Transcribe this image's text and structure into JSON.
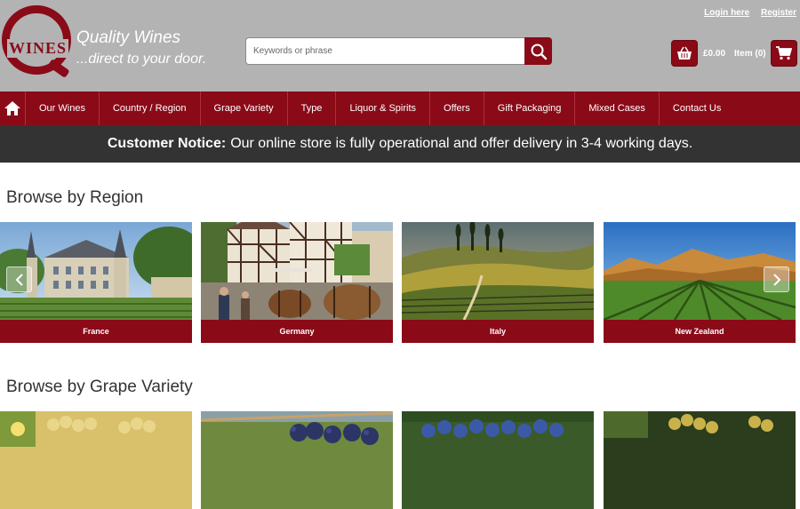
{
  "brand": {
    "logo_text": "WINES",
    "tagline_1": "Quality Wines",
    "tagline_2": "...direct to your door."
  },
  "account": {
    "login_label": "Login here",
    "register_label": "Register"
  },
  "search": {
    "placeholder": "Keywords or phrase",
    "icon": "search-icon"
  },
  "cart": {
    "total": "£0.00",
    "items": "Item (0)"
  },
  "nav": {
    "items": [
      {
        "label": "Our Wines"
      },
      {
        "label": "Country / Region"
      },
      {
        "label": "Grape Variety"
      },
      {
        "label": "Type"
      },
      {
        "label": "Liquor & Spirits"
      },
      {
        "label": "Offers"
      },
      {
        "label": "Gift Packaging"
      },
      {
        "label": "Mixed Cases"
      },
      {
        "label": "Contact Us"
      }
    ]
  },
  "notice": {
    "bold": "Customer Notice:",
    "text": "Our online store is fully operational and offer delivery in 3-4 working days."
  },
  "regions": {
    "title": "Browse by Region",
    "items": [
      {
        "label": "France"
      },
      {
        "label": "Germany"
      },
      {
        "label": "Italy"
      },
      {
        "label": "New Zealand"
      }
    ]
  },
  "grapes": {
    "title": "Browse by Grape Variety"
  },
  "colors": {
    "brand": "#8a0a18",
    "header_bg": "#b3b3b3",
    "notice_bg": "#333333"
  }
}
